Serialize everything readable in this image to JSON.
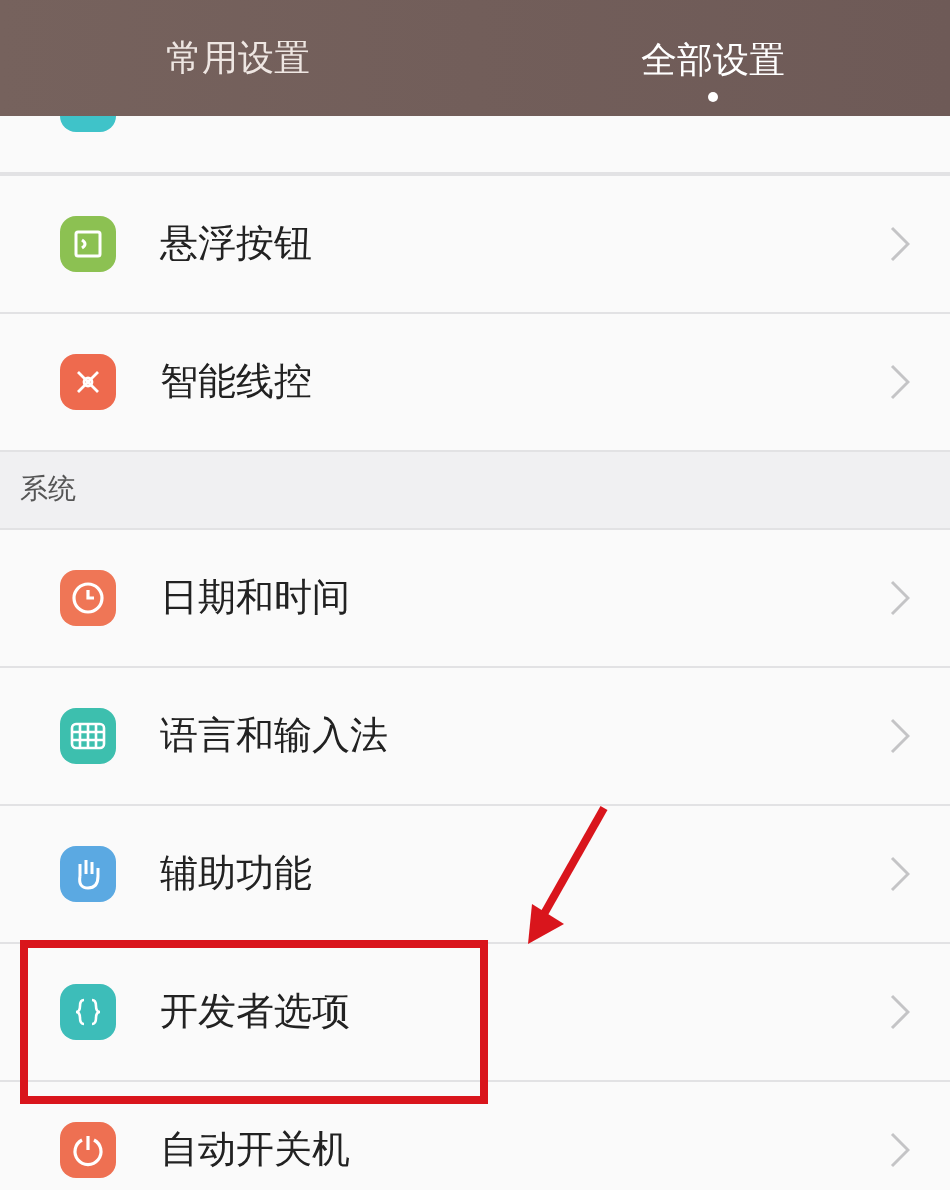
{
  "tabs": [
    {
      "label": "常用设置",
      "selected": false
    },
    {
      "label": "全部设置",
      "selected": true
    }
  ],
  "groups": [
    {
      "items": [
        {
          "label": "悬浮按钮",
          "color": "#8cc152",
          "highlighted": false
        },
        {
          "label": "智能线控",
          "color": "#ee6a4e",
          "highlighted": false
        }
      ]
    },
    {
      "title": "系统",
      "items": [
        {
          "label": "日期和时间",
          "color": "#ef7656",
          "highlighted": false
        },
        {
          "label": "语言和输入法",
          "color": "#3dbfae",
          "highlighted": false
        },
        {
          "label": "辅助功能",
          "color": "#5ba9e2",
          "highlighted": false
        },
        {
          "label": "开发者选项",
          "color": "#3dbdb9",
          "highlighted": true
        },
        {
          "label": "自动开关机",
          "color": "#ee7052",
          "highlighted": false
        }
      ]
    }
  ]
}
